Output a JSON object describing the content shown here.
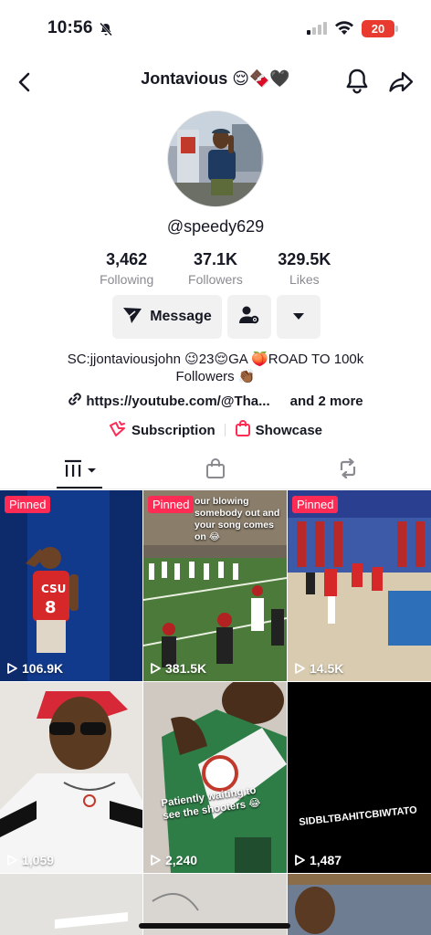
{
  "status": {
    "time": "10:56",
    "battery": "20"
  },
  "header": {
    "title": "Jontavious 😌🍫🖤"
  },
  "profile": {
    "username": "@speedy629",
    "stats": [
      {
        "value": "3,462",
        "label": "Following"
      },
      {
        "value": "37.1K",
        "label": "Followers"
      },
      {
        "value": "329.5K",
        "label": "Likes"
      }
    ],
    "message_label": "Message",
    "bio_line1": "SC:jjontaviousjohn 😉23😌GA 🍑ROAD TO 100k",
    "bio_line2": "Followers 👏🏾",
    "link": "https://youtube.com/@Tha...",
    "link_more": "and 2 more",
    "subscription": "Subscription",
    "showcase": "Showcase"
  },
  "videos": [
    {
      "pinned": "Pinned",
      "views": "106.9K",
      "caption": ""
    },
    {
      "pinned": "Pinned",
      "views": "381.5K",
      "caption": "our blowing somebody out and your song comes on 😂"
    },
    {
      "pinned": "Pinned",
      "views": "14.5K",
      "caption": ""
    },
    {
      "pinned": "",
      "views": "1,059",
      "caption": ""
    },
    {
      "pinned": "",
      "views": "2,240",
      "caption": "Patiently waiting to see the shooters 😂"
    },
    {
      "pinned": "",
      "views": "1,487",
      "caption": "SIDBLTBAHITCBIWTATO"
    }
  ],
  "colors": {
    "accent": "#fe2c55",
    "text": "#161823",
    "muted": "#8a8b91"
  }
}
